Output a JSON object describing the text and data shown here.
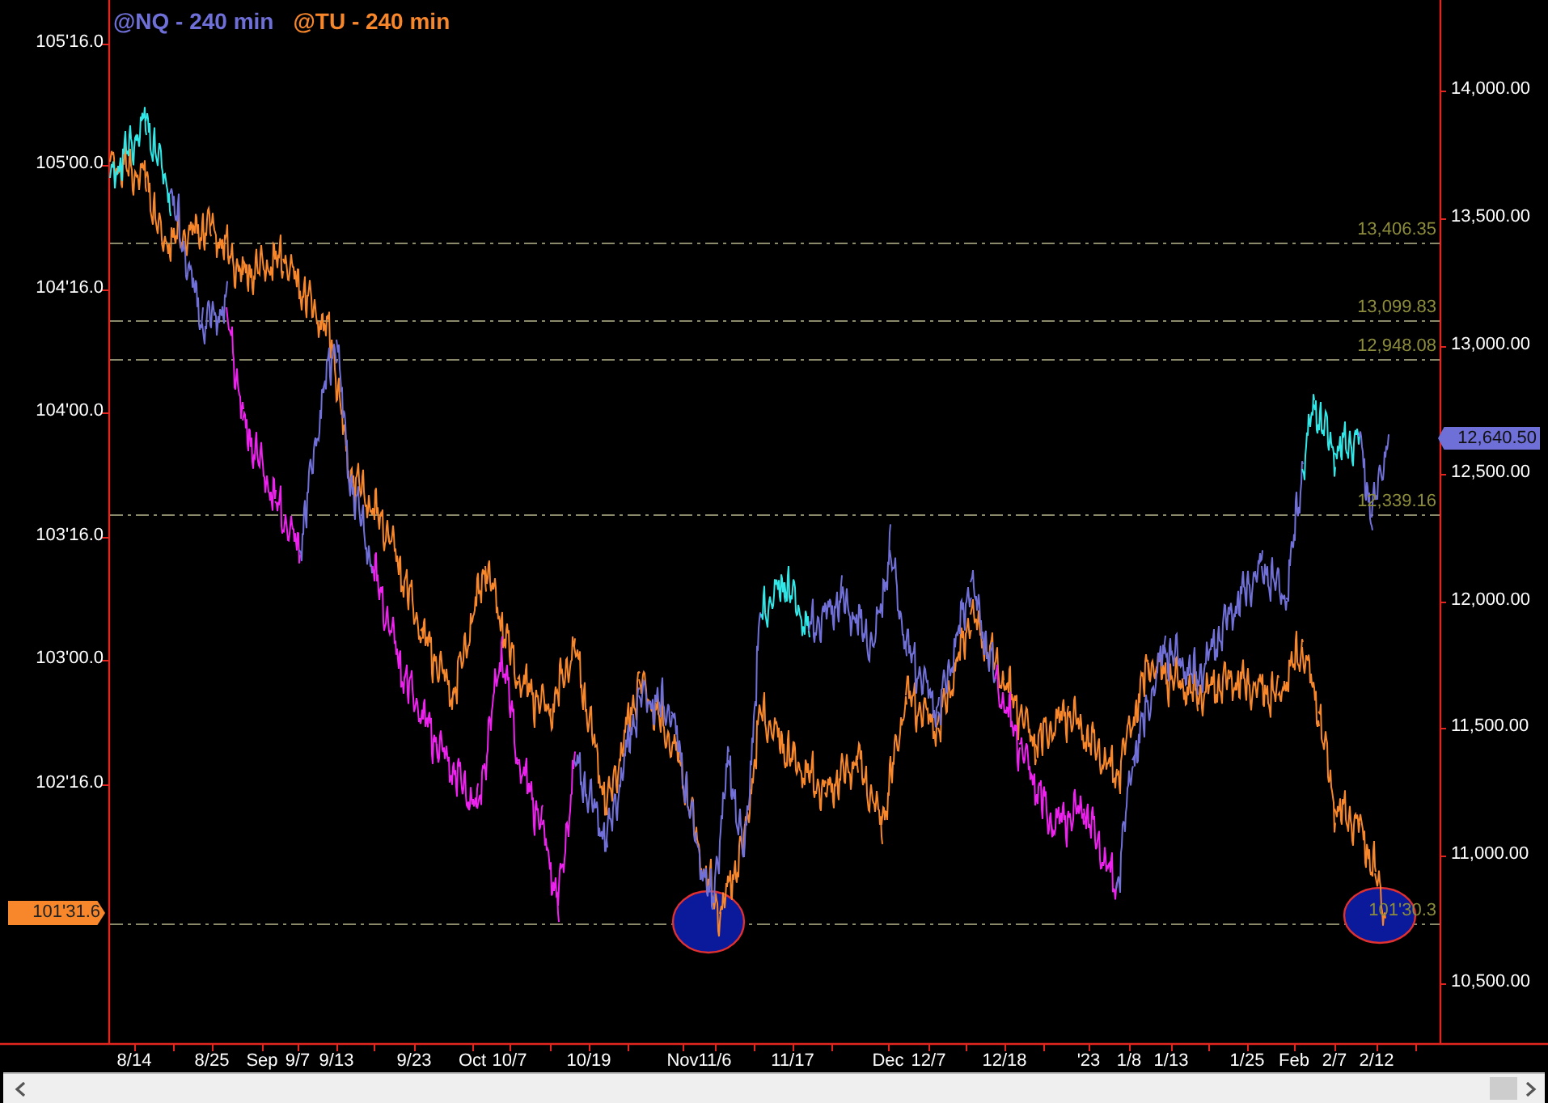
{
  "legend": [
    {
      "label": "@NQ - 240 min",
      "color": "#6f6fd8"
    },
    {
      "label": "@TU - 240 min",
      "color": "#f7872a"
    }
  ],
  "left_axis": {
    "labels": [
      "105'16.0",
      "105'00.0",
      "104'16.0",
      "104'00.0",
      "103'16.0",
      "103'00.0",
      "102'16.0"
    ],
    "tag": "101'31.6"
  },
  "right_axis": {
    "labels": [
      "14,000.00",
      "13,500.00",
      "13,000.00",
      "12,500.00",
      "12,000.00",
      "11,500.00",
      "11,000.00",
      "10,500.00"
    ],
    "tag": "12,640.50"
  },
  "levels": [
    {
      "label": "13,406.35"
    },
    {
      "label": "13,099.83"
    },
    {
      "label": "12,948.08"
    },
    {
      "label": "12,339.16"
    },
    {
      "label": "101'30.3"
    }
  ],
  "x_axis": {
    "labels": [
      "8/14",
      "8/25",
      "Sep",
      "9/7",
      "9/13",
      "9/23",
      "Oct",
      "10/7",
      "10/19",
      "Nov",
      "11/6",
      "11/17",
      "Dec",
      "12/7",
      "12/18",
      "'23",
      "1/8",
      "1/13",
      "1/25",
      "Feb",
      "2/7",
      "2/12"
    ]
  }
}
